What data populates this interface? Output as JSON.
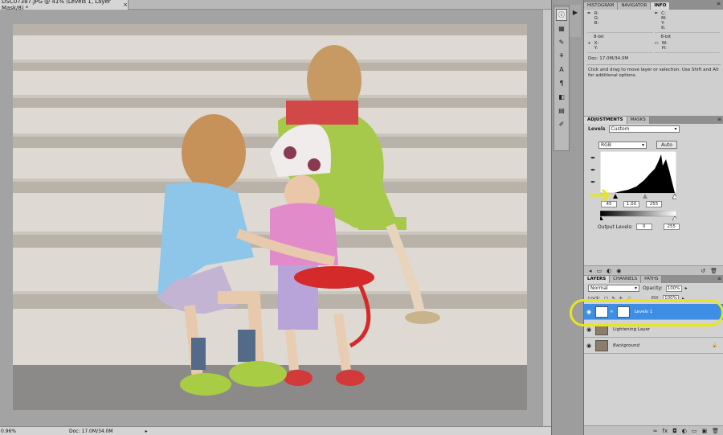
{
  "document": {
    "tab_title": "DSC07387.JPG @ 41% (Levels 1, Layer Mask/8) *",
    "close_glyph": "×",
    "status_zoom": "0.96%",
    "status_doc": "Doc: 17.0M/34.0M",
    "status_arrow": "▸"
  },
  "info_panel": {
    "tabs": [
      "HISTOGRAM",
      "NAVIGATOR",
      "INFO"
    ],
    "active_tab": "INFO",
    "rgb_labels": "R:\nG:\nB:",
    "bit_left": "8-bit",
    "cmyk_labels": "C:\nM:\nY:\nK:",
    "bit_right": "8-bit",
    "xy_labels": "X:\nY:",
    "wh_labels": "W:\nH:",
    "doc_size": "Doc: 17.0M/34.0M",
    "hint": "Click and drag to move layer or selection.  Use Shift and Alt for additional options."
  },
  "adjustments": {
    "tabs": [
      "ADJUSTMENTS",
      "MASKS"
    ],
    "title": "Levels",
    "preset": "Custom",
    "channel": "RGB",
    "auto_label": "Auto",
    "input_black": "45",
    "input_gamma": "1.00",
    "input_white": "255",
    "output_label": "Output Levels:",
    "output_black": "0",
    "output_white": "255"
  },
  "layers_panel": {
    "tabs": [
      "LAYERS",
      "CHANNELS",
      "PATHS"
    ],
    "blend_mode": "Normal",
    "opacity_label": "Opacity:",
    "opacity_value": "100%",
    "lock_label": "Lock:",
    "fill_label": "Fill:",
    "fill_value": "100%",
    "layers": [
      {
        "name": "Levels 1",
        "selected": true
      },
      {
        "name": "Lightening Layer",
        "selected": false
      },
      {
        "name": "Background",
        "selected": false
      }
    ]
  },
  "colors": {
    "selection_blue": "#3d8ee4",
    "annotation_yellow": "#e6e620",
    "panel_bg": "#d2d2d2"
  },
  "icons": [
    "eye-icon",
    "lock-icon",
    "eyedropper-icon",
    "link-icon",
    "fx-icon",
    "trash-icon",
    "new-layer-icon",
    "folder-icon",
    "panel-menu-icon"
  ]
}
